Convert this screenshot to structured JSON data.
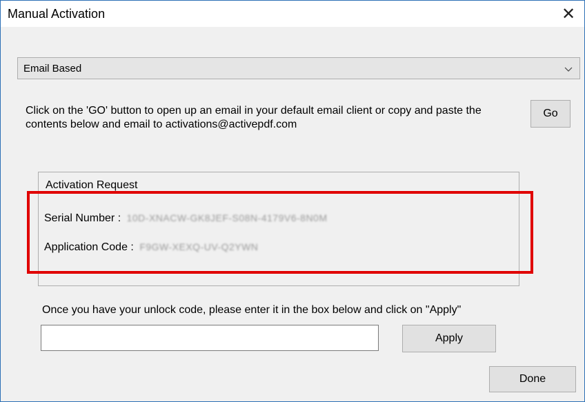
{
  "window": {
    "title": "Manual Activation",
    "close_glyph": "✕"
  },
  "activation_method": {
    "selected": "Email Based"
  },
  "instructions": "Click on the 'GO' button to open up an email in your default email client or copy and paste the contents below and email to activations@activepdf.com",
  "go_button": "Go",
  "activation_request": {
    "title": "Activation Request",
    "serial_label": "Serial Number :",
    "serial_value": "10D-XNACW-GK8JEF-S08N-4179V6-8N0M",
    "appcode_label": "Application Code :",
    "appcode_value": "F9GW-XEXQ-UV-Q2YWN"
  },
  "unlock": {
    "message": "Once you have your unlock code, please enter it in the box below and click on \"Apply\"",
    "input_value": "",
    "apply_button": "Apply"
  },
  "done_button": "Done",
  "colors": {
    "highlight": "#e00000",
    "window_border": "#2b6fb5",
    "background": "#f0f0f0"
  }
}
